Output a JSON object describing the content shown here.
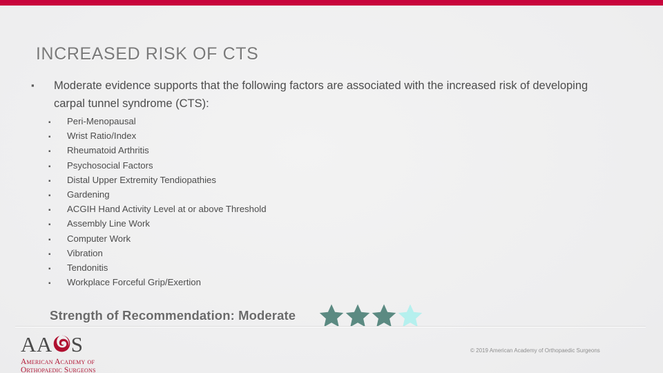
{
  "slide": {
    "title": "INCREASED RISK OF CTS",
    "accent_color": "#c8043c",
    "background_color": "#eeeeef",
    "title_color": "#7a7a7a"
  },
  "lead_bullet": {
    "marker": "▪",
    "text": "Moderate evidence supports that the following factors are associated with the increased risk of developing carpal tunnel syndrome (CTS):"
  },
  "sub_bullets": {
    "marker": "▪",
    "items": [
      "Peri-Menopausal",
      "Wrist Ratio/Index",
      "Rheumatoid Arthritis",
      "Psychosocial Factors",
      "Distal Upper Extremity Tendiopathies",
      "Gardening",
      "ACGIH Hand Activity Level at or above Threshold",
      "Assembly Line Work",
      "Computer Work",
      "Vibration",
      "Tendonitis",
      "Workplace Forceful Grip/Exertion"
    ]
  },
  "strength_of_recommendation": {
    "label": "Strength of Recommendation: Moderate",
    "rating_filled": 3,
    "rating_total": 4,
    "filled_color": "#5b8a82",
    "empty_color": "#b5f0ee"
  },
  "footer": {
    "logo_wordmark_a1": "A",
    "logo_wordmark_a2": "A",
    "logo_wordmark_s": "S",
    "logo_swirl_name": "aaos-swirl-o",
    "logo_subtitle_line1": "American Academy of",
    "logo_subtitle_line2": "Orthopaedic Surgeons",
    "logo_red": "#b01030",
    "copyright": "© 2019 American Academy of Orthopaedic Surgeons"
  }
}
